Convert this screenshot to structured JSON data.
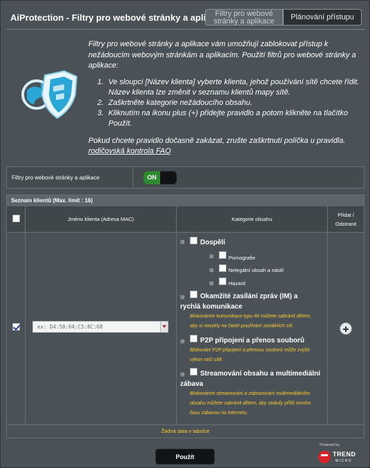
{
  "header": {
    "title": "AiProtection - Filtry pro webové stránky a aplikace",
    "tabs": [
      {
        "label": "Filtry pro webové stránky a aplikace",
        "active": true
      },
      {
        "label": "Plánování přístupu",
        "active": false
      }
    ]
  },
  "info": {
    "intro": "Filtry pro webové stránky a aplikace vám umožňují zablokovat přístup k nežádoucím webovým stránkám a aplikacím. Použití filtrů pro webové stránky a aplikace:",
    "steps": [
      {
        "num": "1.",
        "text": "Ve sloupci [Název klienta] vyberte klienta, jehož používání sítě chcete řídit. Název klienta lze změnit v seznamu klientů mapy sítě."
      },
      {
        "num": "2.",
        "text": "Zaškrtněte kategorie nežádoucího obsahu."
      },
      {
        "num": "3.",
        "text": "Kliknutím na ikonu plus (+) přidejte pravidlo a potom klikněte na tlačítko Použít."
      }
    ],
    "outro": "Pokud chcete pravidlo dočasně zakázat, zrušte zaškrtnutí políčka u pravidla.",
    "faq_link": "rodičovská kontrola FAQ"
  },
  "toggle": {
    "label": "Filtry pro webové stránky a aplikace",
    "state": "ON"
  },
  "client_table": {
    "title": "Seznam klientů (Max. limit : 16)",
    "columns": {
      "client": "Jméno klienta (Adresa MAC)",
      "category": "Kategorie obsahu",
      "add_remove_line1": "Přidat /",
      "add_remove_line2": "Odstranit"
    },
    "mac_placeholder": "ex: D4:50:64:C5:8C:68",
    "categories": {
      "adult": {
        "label": "Dospělí",
        "subs": [
          "Pornografie",
          "Nelegální obsah a násilí",
          "Hazard"
        ]
      },
      "im": {
        "label_line1": "Okamžité zasílání zpráv (IM) a",
        "label_line2": "rychlá komunikace",
        "desc_line1": "Blokováním komunikace typu IM můžete zabránit dětem,",
        "desc_line2": "aby si navykly na časté používání sociálních sítí."
      },
      "p2p": {
        "label": "P2P připojení a přenos souborů",
        "desc_line1": "Blokování P2P připojení a přenosu souborů může zvýšit",
        "desc_line2": "výkon vaší sítě."
      },
      "streaming": {
        "label_line1": "Streamování obsahu a multimediální",
        "label_line2": "zábava",
        "desc_line1": "Blokováním streamování a zobrazování multimediálního",
        "desc_line2": "obsahu můžete zabránit dětem, aby strávily příliš mnoho",
        "desc_line3": "času zábavou na Internetu."
      }
    },
    "empty_text": "Žádná data v tabulce"
  },
  "footer": {
    "apply_label": "Použít",
    "powered_by": "Powered by",
    "brand_line1": "TREND",
    "brand_line2": "MICRO"
  },
  "icons": {
    "logo": "globe-shield-icon",
    "add": "plus-circle-icon",
    "expand": "plus-square-icon",
    "dropdown": "chevron-down-icon"
  }
}
